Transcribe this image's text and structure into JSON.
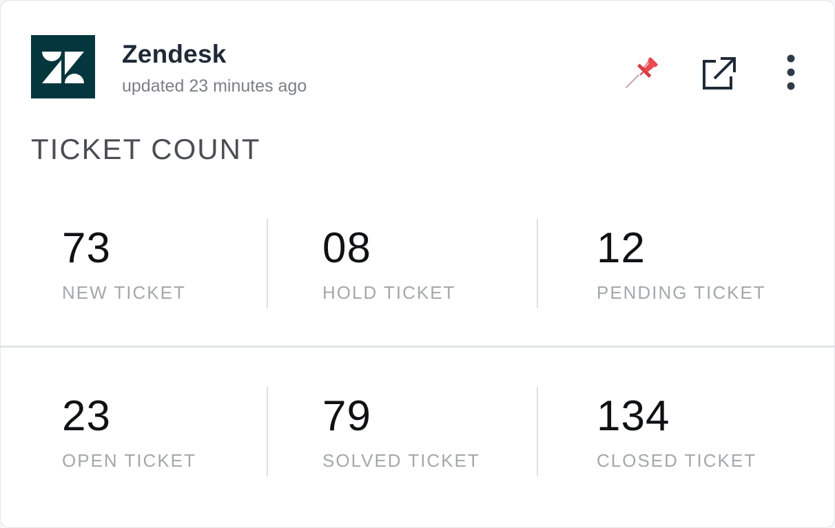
{
  "widget": {
    "app_name": "Zendesk",
    "updated_text": "updated 23 minutes ago",
    "logo_icon": "zendesk-logo",
    "actions": [
      {
        "name": "pin",
        "icon": "pushpin-icon"
      },
      {
        "name": "open-external",
        "icon": "external-link-icon"
      },
      {
        "name": "more",
        "icon": "vertical-dots-icon"
      }
    ],
    "brand_color": "#03363d",
    "pin_color": "#e8494f"
  },
  "section_title": "TICKET COUNT",
  "stats": [
    {
      "value": "73",
      "label": "NEW TICKET"
    },
    {
      "value": "08",
      "label": "HOLD TICKET"
    },
    {
      "value": "12",
      "label": "PENDING TICKET"
    },
    {
      "value": "23",
      "label": "OPEN TICKET"
    },
    {
      "value": "79",
      "label": "SOLVED TICKET"
    },
    {
      "value": "134",
      "label": "CLOSED TICKET"
    }
  ]
}
